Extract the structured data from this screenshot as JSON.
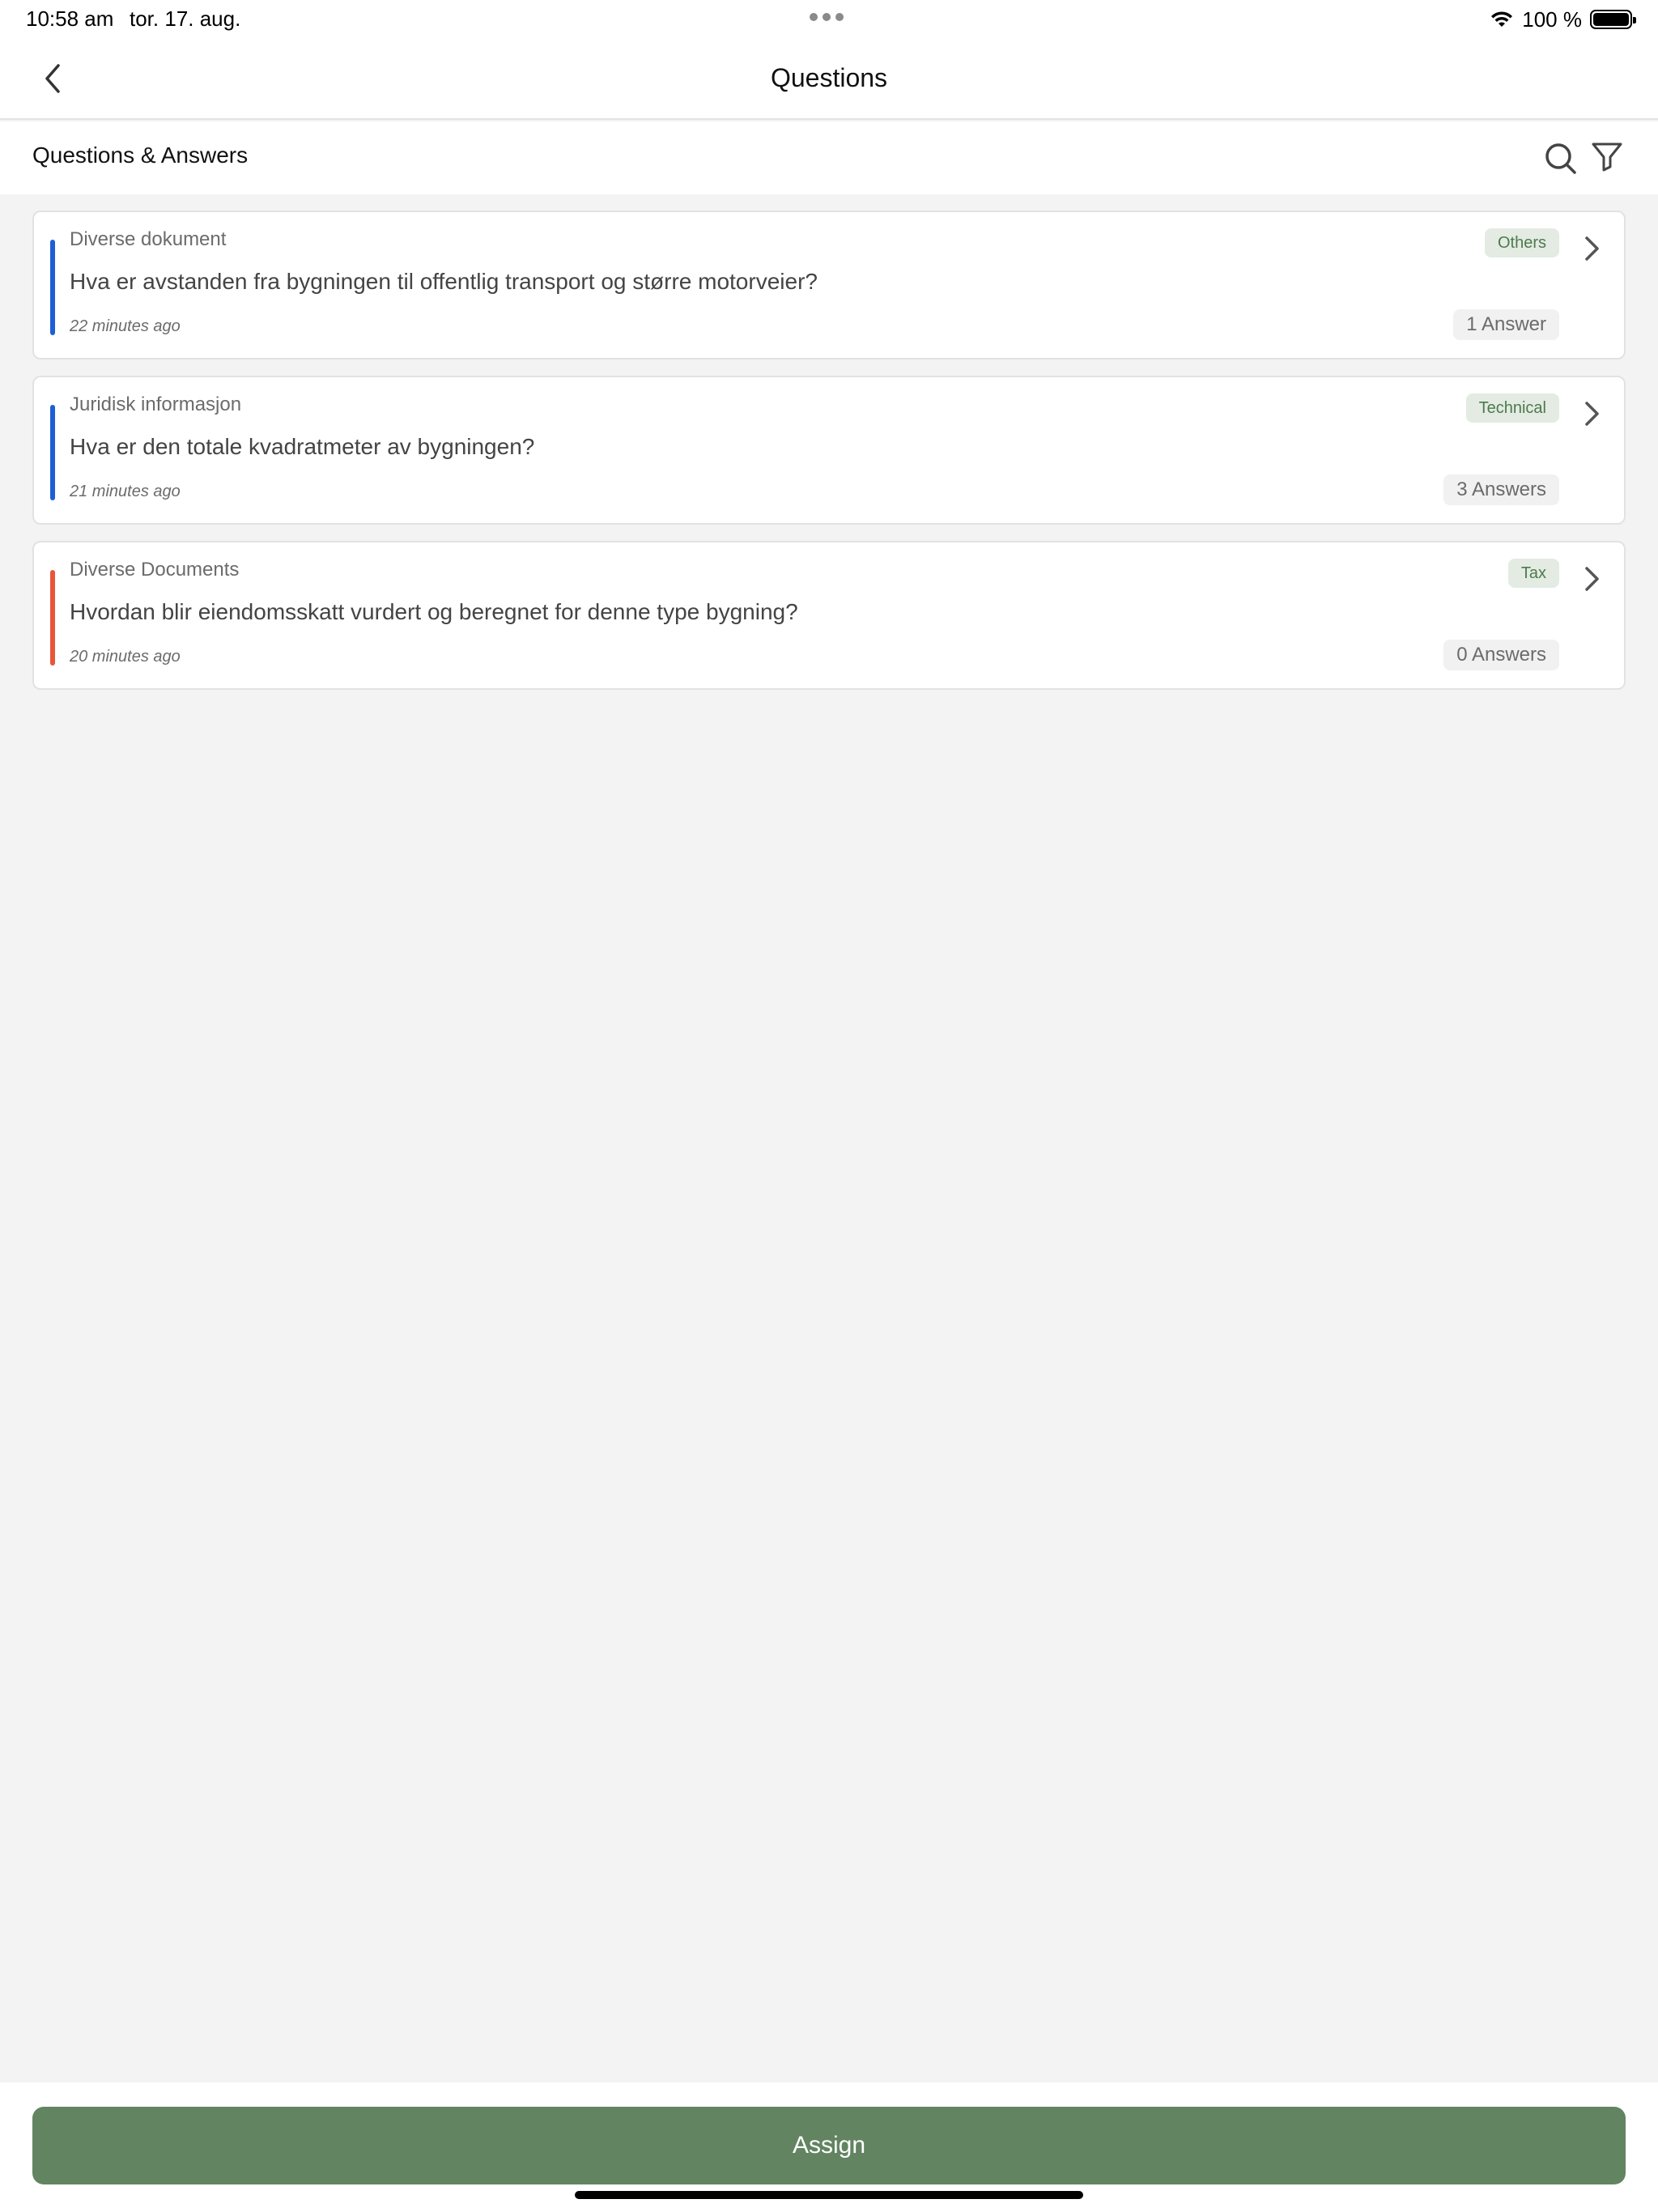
{
  "status_bar": {
    "time": "10:58 am",
    "date": "tor. 17. aug.",
    "battery": "100 %",
    "wifi_icon": "wifi-icon",
    "battery_icon": "battery-icon"
  },
  "nav": {
    "title": "Questions",
    "back_icon": "chevron-left-icon"
  },
  "section": {
    "title": "Questions & Answers",
    "search_icon": "search-icon",
    "filter_icon": "filter-icon"
  },
  "questions": [
    {
      "category": "Diverse dokument",
      "question": "Hva er avstanden fra bygningen til offentlig transport og større motorveier?",
      "time": "22 minutes ago",
      "tag": "Others",
      "answers": "1 Answer",
      "bar_color": "#1f5fd6"
    },
    {
      "category": "Juridisk informasjon",
      "question": "Hva er den totale kvadratmeter av bygningen?",
      "time": "21 minutes ago",
      "tag": "Technical",
      "answers": "3 Answers",
      "bar_color": "#1f5fd6"
    },
    {
      "category": "Diverse Documents",
      "question": "Hvordan blir eiendomsskatt vurdert og beregnet for denne type bygning?",
      "time": "20 minutes ago",
      "tag": "Tax",
      "answers": "0 Answers",
      "bar_color": "#e8553a"
    }
  ],
  "footer": {
    "assign_label": "Assign"
  },
  "colors": {
    "accent": "#628461",
    "tag_bg": "#e3ebe3",
    "tag_text": "#4d7a4d"
  }
}
